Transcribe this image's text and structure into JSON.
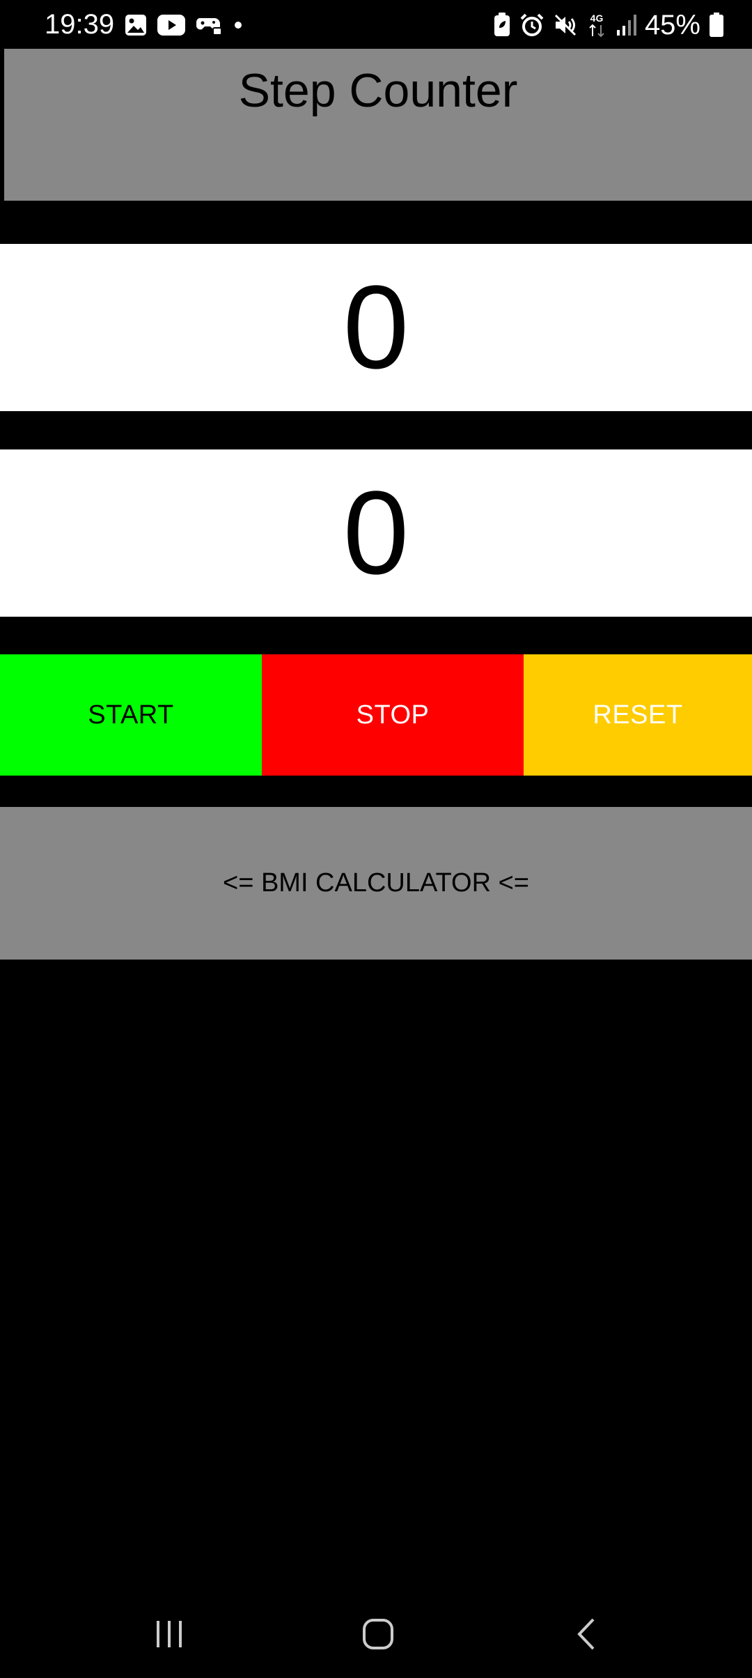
{
  "status_bar": {
    "time": "19:39",
    "left_icons": [
      "gallery-icon",
      "youtube-icon",
      "game-icon",
      "dot-icon"
    ],
    "right_icons": [
      "battery-saver-icon",
      "alarm-icon",
      "mute-icon",
      "network-4g-icon",
      "signal-icon"
    ],
    "network": "4G",
    "battery_percent": "45%"
  },
  "app": {
    "title": "Step Counter"
  },
  "counters": {
    "primary": "0",
    "secondary": "0"
  },
  "controls": {
    "start": {
      "label": "START",
      "color": "#00ff00",
      "text_color": "#000000"
    },
    "stop": {
      "label": "STOP",
      "color": "#ff0000",
      "text_color": "#ffffff"
    },
    "reset": {
      "label": "RESET",
      "color": "#ffcc00",
      "text_color": "#ffffff"
    }
  },
  "bmi": {
    "label": "<= BMI CALCULATOR <="
  },
  "colors": {
    "background": "#000000",
    "panel_gray": "#888888",
    "counter_bg": "#ffffff"
  },
  "nav": {
    "items": [
      "recents-icon",
      "home-icon",
      "back-icon"
    ]
  }
}
